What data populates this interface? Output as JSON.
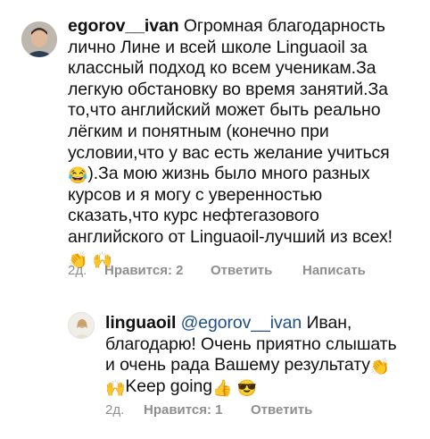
{
  "comments": [
    {
      "username": "egorov__ivan",
      "lines": [
        "Огромная благодарность",
        "лично Лине и всей школе Linguaoil за",
        "классный подход ко всем ученикам.За",
        "легкую обстановку во время занятий.За",
        "то,что английский может быть реально",
        "лёгким и понятным (конечно при",
        "условии,что у вас есть желание учиться",
        ").За мою жизнь было много разных",
        "курсов и я могу с уверенностью",
        "сказать,что курс нефтегазового",
        "английского от Linguaoil-лучший из всех!"
      ],
      "emojis": {
        "laugh": "😂",
        "clap": "👏",
        "raised_hands": "🙌"
      },
      "meta": {
        "time": "2д.",
        "likes": "Нравится: 2",
        "reply": "Ответить",
        "message": "Написать"
      }
    },
    {
      "username": "linguaoil",
      "mention": "@egorov__ivan",
      "lines": [
        "Иван,",
        "благодарю! Очень приятно слышать",
        "и очень рада Вашему результату",
        "Keep going"
      ],
      "emojis": {
        "clap": "👏",
        "raised_hands": "🙌",
        "thumbs_up": "👍",
        "sunglasses": "😎"
      },
      "meta": {
        "time": "2д.",
        "likes": "Нравится: 1",
        "reply": "Ответить"
      }
    }
  ],
  "colors": {
    "text": "#111111",
    "meta": "#8e8e8e",
    "mention": "#1f4f86"
  }
}
